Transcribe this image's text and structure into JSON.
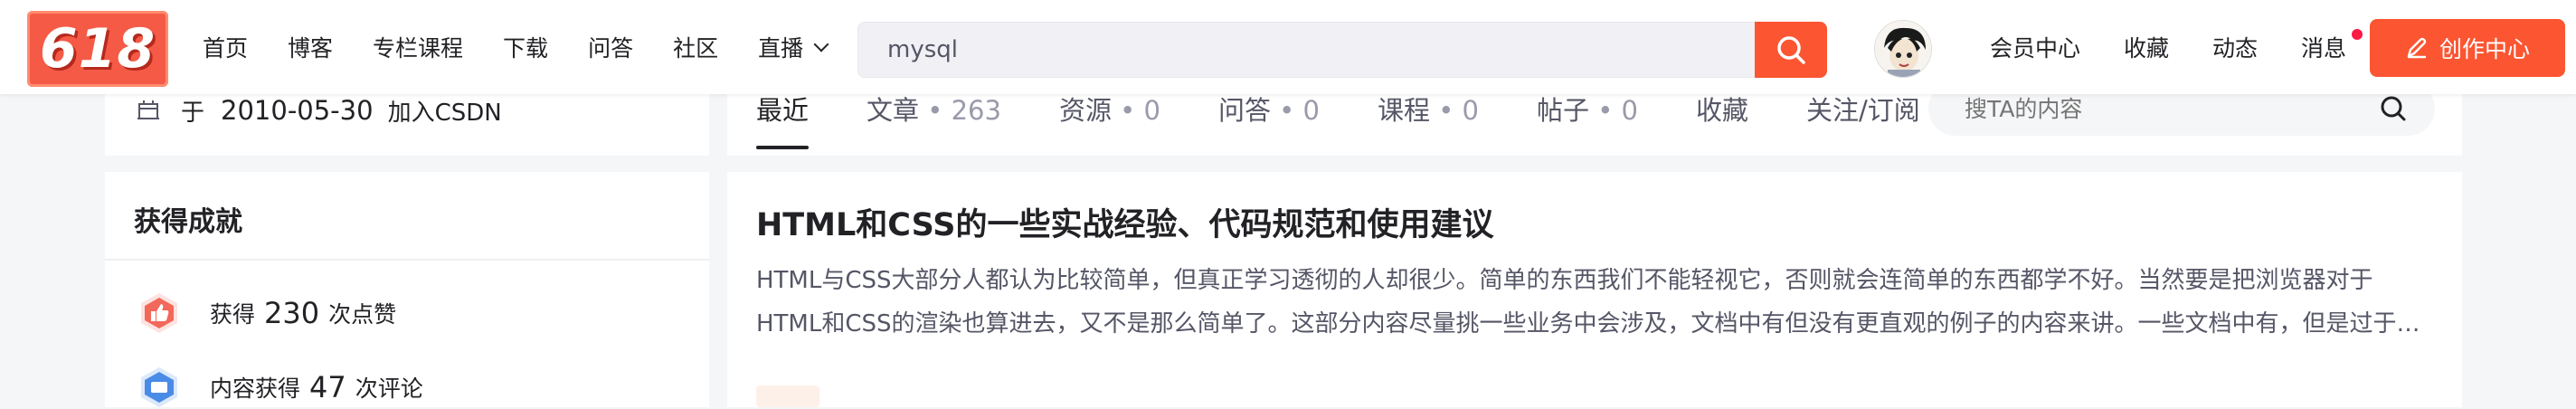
{
  "brand": {
    "logo_text": "618",
    "accent": "#fc5531"
  },
  "nav": {
    "items": [
      "首页",
      "博客",
      "专栏课程",
      "下载",
      "问答",
      "社区"
    ],
    "live_label": "直播"
  },
  "search": {
    "value": "mysql"
  },
  "right_nav": {
    "items": [
      "会员中心",
      "收藏",
      "动态",
      "消息"
    ],
    "create_label": "创作中心"
  },
  "profile": {
    "join_prefix": "于",
    "join_date": "2010-05-30",
    "join_suffix": "加入CSDN"
  },
  "achievements": {
    "title": "获得成就",
    "rows": [
      {
        "prefix": "获得",
        "number": "230",
        "suffix": "次点赞",
        "icon": "thumb-up-badge-icon"
      },
      {
        "prefix": "内容获得",
        "number": "47",
        "suffix": "次评论",
        "icon": "comment-badge-icon"
      }
    ]
  },
  "tabs": [
    {
      "label": "最近",
      "count": ""
    },
    {
      "label": "文章",
      "count": "263"
    },
    {
      "label": "资源",
      "count": "0"
    },
    {
      "label": "问答",
      "count": "0"
    },
    {
      "label": "课程",
      "count": "0"
    },
    {
      "label": "帖子",
      "count": "0"
    },
    {
      "label": "收藏",
      "count": ""
    },
    {
      "label": "关注/订阅",
      "count": ""
    }
  ],
  "tab_count_separator": " • ",
  "ta_search": {
    "placeholder": "搜TA的内容"
  },
  "article": {
    "title": "HTML和CSS的一些实战经验、代码规范和使用建议",
    "description": "HTML与CSS大部分人都认为比较简单，但真正学习透彻的人却很少。简单的东西我们不能轻视它，否则就会连简单的东西都学不好。当然要是把浏览器对于HTML和CSS的渲染也算进去，又不是那么简单了。这部分内容尽量挑一些业务中会涉及，文档中有但没有更直观的例子的内容来讲。一些文档中有，但是过于冗长的部分，也挑..."
  }
}
